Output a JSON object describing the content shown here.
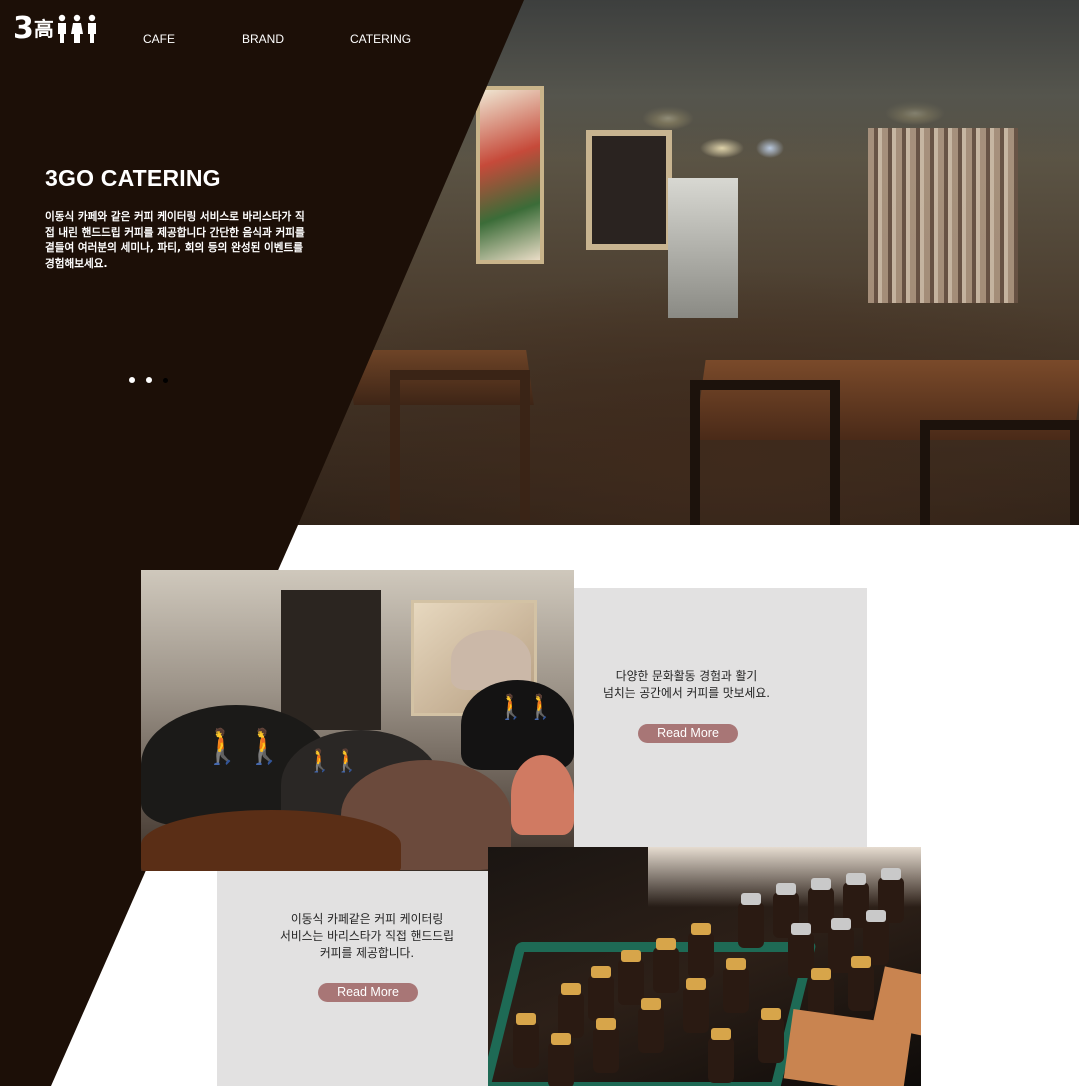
{
  "header": {
    "logo_text_number": "3",
    "logo_text_hanja": "高",
    "nav": [
      {
        "label": "CAFE"
      },
      {
        "label": "BRAND"
      },
      {
        "label": "CATERING"
      }
    ]
  },
  "hero": {
    "title": "3GO CATERING",
    "description": "이동식 카페와 같은 커피 케이터링 서비스로 바리스타가 직접 내린 핸드드립 커피를 제공합니다 간단한 음식과 커피를 곁들여 여러분의 세미나, 파티, 회의 등의 완성된 이벤트를 경험해보세요.",
    "slider": {
      "total": 3,
      "active": 3
    }
  },
  "section_culture": {
    "text": "다양한 문화활동 경험과 활기\n넘치는 공간에서 커피를 맛보세요.",
    "button_label": "Read More"
  },
  "section_catering": {
    "text": "이동식 카페같은 커피 케이터링\n서비스는 바리스타가 직접 핸드드립\n커피를 제공합니다.",
    "button_label": "Read More"
  },
  "colors": {
    "dark_brown": "#1c0f07",
    "panel_gray": "#e2e1e1",
    "button_rose": "#a87676"
  }
}
